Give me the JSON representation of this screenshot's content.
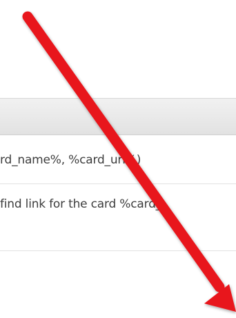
{
  "table": {
    "header": "",
    "rows": [
      {
        "text": "rd_name%, %card_url%)"
      },
      {
        "text": "find link for the card %card_"
      }
    ]
  },
  "colors": {
    "arrow": "#e8161b",
    "header_bg": "#e9e9e9",
    "text": "#3d3d3d"
  }
}
